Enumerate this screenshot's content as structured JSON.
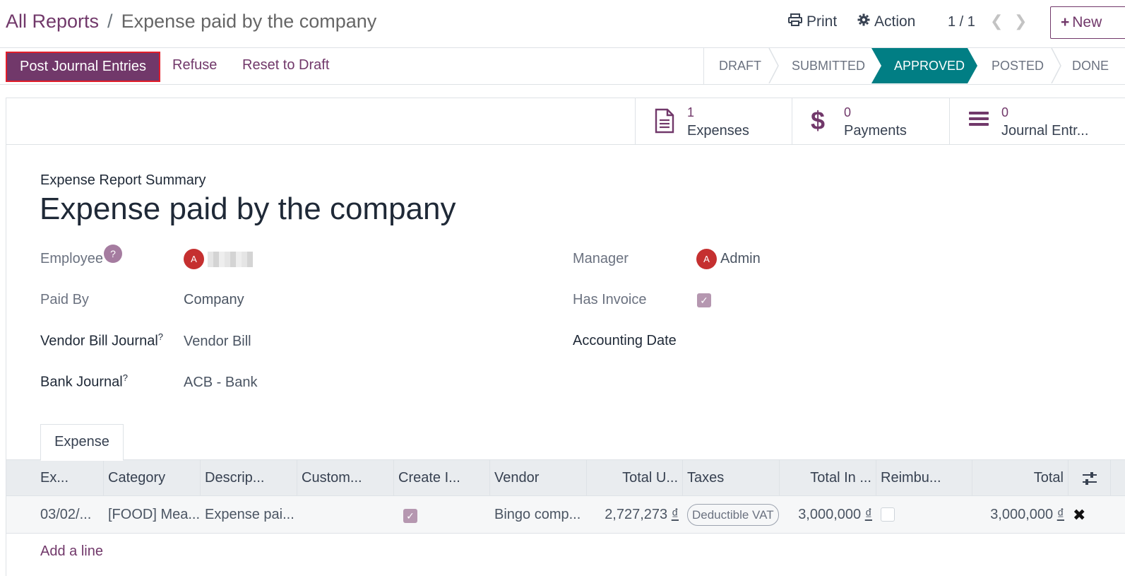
{
  "breadcrumb": {
    "root": "All Reports",
    "separator": "/",
    "current": "Expense paid by the company"
  },
  "header": {
    "print_label": "Print",
    "action_label": "Action",
    "pager": "1 / 1",
    "new_label": "New",
    "icons": {
      "print": "printer-icon",
      "action": "gear-icon",
      "prev": "chevron-left-icon",
      "next": "chevron-right-icon",
      "new": "plus-icon"
    }
  },
  "statusbar": {
    "post_label": "Post Journal Entries",
    "refuse_label": "Refuse",
    "reset_label": "Reset to Draft",
    "stages": [
      "DRAFT",
      "SUBMITTED",
      "APPROVED",
      "POSTED",
      "DONE"
    ],
    "active_stage": "APPROVED"
  },
  "smart_buttons": [
    {
      "value": "1",
      "label": "Expenses",
      "icon": "document-icon"
    },
    {
      "value": "0",
      "label": "Payments",
      "icon": "dollar-icon"
    },
    {
      "value": "0",
      "label": "Journal Entr...",
      "icon": "list-icon"
    }
  ],
  "form": {
    "subtitle": "Expense Report Summary",
    "title": "Expense paid by the company",
    "employee_label": "Employee",
    "employee_help": "?",
    "employee_avatar": "A",
    "manager_label": "Manager",
    "manager_avatar": "A",
    "manager_value": "Admin",
    "paid_by_label": "Paid By",
    "paid_by_value": "Company",
    "has_invoice_label": "Has Invoice",
    "has_invoice_checked": true,
    "vendor_bill_journal_label": "Vendor Bill Journal",
    "vendor_bill_journal_value": "Vendor Bill",
    "accounting_date_label": "Accounting Date",
    "bank_journal_label": "Bank Journal",
    "bank_journal_value": "ACB - Bank",
    "help_mark": "?"
  },
  "notebook": {
    "tab_label": "Expense",
    "columns": [
      "Ex...",
      "Category",
      "Descrip...",
      "Custom...",
      "Create I...",
      "Vendor",
      "Total U...",
      "Taxes",
      "Total In ...",
      "Reimbu...",
      "Total"
    ],
    "rows": [
      {
        "date": "03/02/...",
        "category": "[FOOD] Mea...",
        "description": "Expense pai...",
        "customer": "",
        "create_invoice": true,
        "vendor": "Bingo comp...",
        "total_untaxed": "2,727,273",
        "taxes": "Deductible VAT",
        "total_incl": "3,000,000",
        "reimbursed": false,
        "total": "3,000,000"
      }
    ],
    "currency": "₫",
    "add_line_label": "Add a line"
  },
  "colors": {
    "primary": "#71386a",
    "active_stage": "#017e84",
    "highlight_border": "#e11d2a"
  }
}
